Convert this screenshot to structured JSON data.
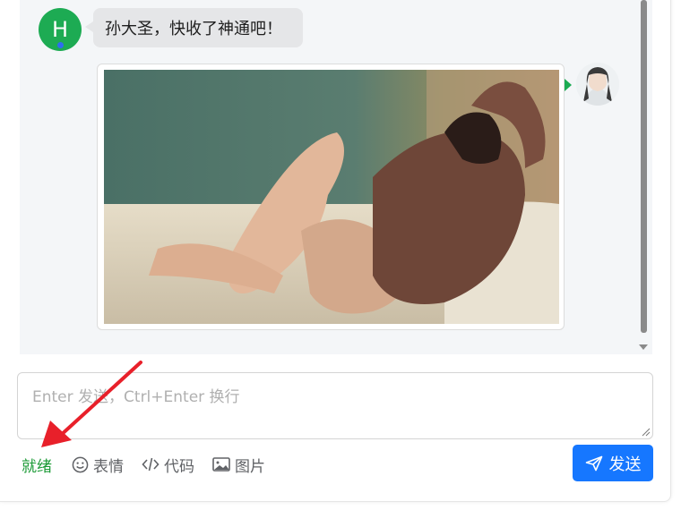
{
  "messages": [
    {
      "sender": "H",
      "text": "孙大圣，快收了神通吧！"
    },
    {
      "sender": "self",
      "kind": "image"
    }
  ],
  "composer": {
    "placeholder": "Enter 发送，Ctrl+Enter 换行",
    "value": ""
  },
  "toolbar": {
    "status": "就绪",
    "emoji_label": "表情",
    "code_label": "代码",
    "image_label": "图片",
    "send_label": "发送"
  },
  "colors": {
    "avatar_green": "#1dab53",
    "send_blue": "#1677ff",
    "status_green": "#1a9a35",
    "annotation_red": "#e8202a"
  },
  "icons": [
    "smile-icon",
    "code-icon",
    "image-icon",
    "paper-plane-icon"
  ]
}
